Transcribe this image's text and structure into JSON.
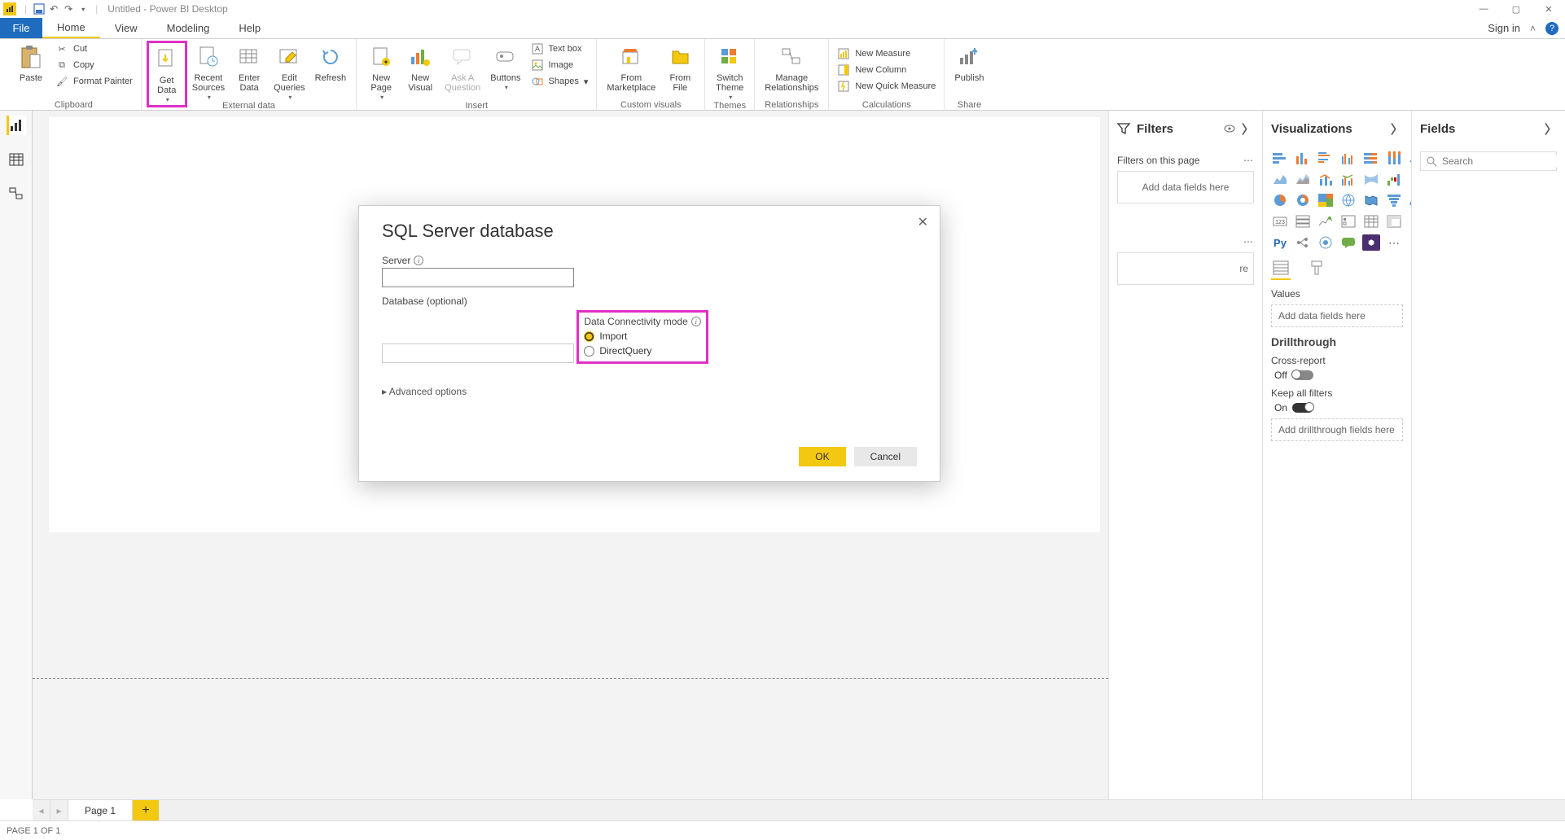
{
  "titlebar": {
    "doc_title": "Untitled - Power BI Desktop"
  },
  "tabs": {
    "file": "File",
    "home": "Home",
    "view": "View",
    "modeling": "Modeling",
    "help": "Help",
    "signin": "Sign in"
  },
  "ribbon": {
    "clipboard": {
      "paste": "Paste",
      "cut": "Cut",
      "copy": "Copy",
      "format_painter": "Format Painter",
      "label": "Clipboard"
    },
    "external": {
      "get_data": "Get\nData",
      "recent_sources": "Recent\nSources",
      "enter_data": "Enter\nData",
      "edit_queries": "Edit\nQueries",
      "refresh": "Refresh",
      "label": "External data"
    },
    "insert": {
      "new_page": "New\nPage",
      "new_visual": "New\nVisual",
      "ask": "Ask A\nQuestion",
      "buttons": "Buttons",
      "textbox": "Text box",
      "image": "Image",
      "shapes": "Shapes",
      "label": "Insert"
    },
    "custom": {
      "marketplace": "From\nMarketplace",
      "file": "From\nFile",
      "label": "Custom visuals"
    },
    "themes": {
      "switch": "Switch\nTheme",
      "label": "Themes"
    },
    "rel": {
      "manage": "Manage\nRelationships",
      "label": "Relationships"
    },
    "calc": {
      "new_measure": "New Measure",
      "new_column": "New Column",
      "new_quick": "New Quick Measure",
      "label": "Calculations"
    },
    "share": {
      "publish": "Publish",
      "label": "Share"
    }
  },
  "filters": {
    "title": "Filters",
    "on_page": "Filters on this page",
    "add": "Add data fields here",
    "all_pages_add": "re"
  },
  "viz": {
    "title": "Visualizations",
    "values": "Values",
    "add_fields": "Add data fields here",
    "drillthrough": "Drillthrough",
    "cross_report": "Cross-report",
    "off": "Off",
    "keep_filters": "Keep all filters",
    "on": "On",
    "add_drill": "Add drillthrough fields here"
  },
  "fields": {
    "title": "Fields",
    "search": "Search"
  },
  "pages": {
    "p1": "Page 1",
    "status": "PAGE 1 OF 1"
  },
  "dialog": {
    "title": "SQL Server database",
    "server_label": "Server",
    "db_label": "Database (optional)",
    "conn_mode": "Data Connectivity mode",
    "import": "Import",
    "directquery": "DirectQuery",
    "advanced": "Advanced options",
    "ok": "OK",
    "cancel": "Cancel"
  }
}
